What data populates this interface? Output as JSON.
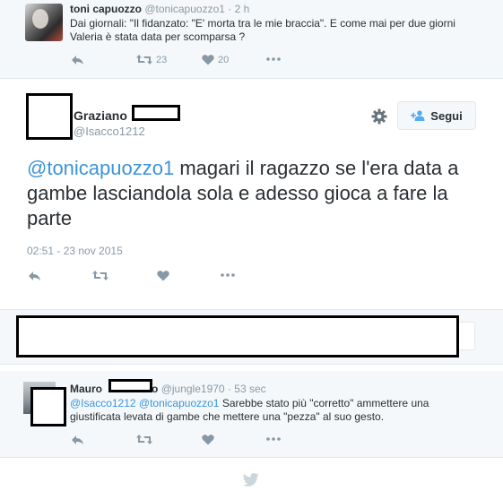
{
  "parent_tweet": {
    "author_name": "toni capuozzo",
    "author_handle": "@tonicapuozzo1",
    "separator": "·",
    "time": "2 h",
    "text": "Dai giornali: \"Il fidanzato: \"E' morta tra le mie braccia\". E come mai per due giorni Valeria è stata data per scomparsa ?",
    "retweet_count": "23",
    "like_count": "20"
  },
  "focused_tweet": {
    "author_name": "Graziano",
    "author_handle": "@Isacco1212",
    "follow_label": "Segui",
    "mention": "@tonicapuozzo1",
    "text": " magari il ragazzo se l'era data a gambe lasciandola sola e adesso gioca a fare la parte",
    "timestamp": "02:51 - 23 nov 2015"
  },
  "reply_box": {
    "placeholder": ""
  },
  "reply_tweet": {
    "author_name_visible_start": "Mauro",
    "author_name_visible_end": "o",
    "author_handle": "@jungle1970",
    "separator": "·",
    "time": "53 sec",
    "mention_1": "@Isacco1212",
    "mention_2": "@tonicapuozzo1",
    "text": " Sarebbe stato più  \"corretto\" ammettere una giustificata levata di gambe che mettere una \"pezza\" al suo gesto."
  },
  "colors": {
    "link_blue": "#3b94d9",
    "icon_gray": "#8899a6",
    "muted_bg": "#f5f8fa",
    "follow_icon_blue": "#55acee"
  },
  "icons": [
    "reply-icon",
    "retweet-icon",
    "like-icon",
    "more-icon",
    "gear-icon",
    "add-user-icon",
    "twitter-bird-icon"
  ]
}
